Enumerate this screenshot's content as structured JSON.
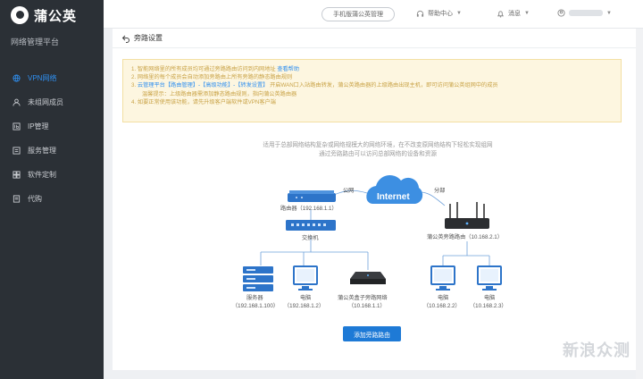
{
  "app": {
    "logo": "蒲公英",
    "subtitle": "网络管理平台"
  },
  "sidebar": {
    "items": [
      {
        "label": "VPN网络",
        "icon": "globe-icon",
        "active": true
      },
      {
        "label": "未组网成员",
        "icon": "user-icon"
      },
      {
        "label": "IP管理",
        "icon": "ip-icon"
      },
      {
        "label": "服务管理",
        "icon": "service-icon"
      },
      {
        "label": "软件定制",
        "icon": "software-icon"
      },
      {
        "label": "代购",
        "icon": "purchase-icon"
      }
    ]
  },
  "topbar": {
    "pill_button": "手机版蒲公英管理",
    "help": "帮助中心",
    "messages": "消息"
  },
  "page": {
    "title": "旁路设置"
  },
  "notice": {
    "line1_prefix": "1. 智能网络里的所有成员均可通过旁路路由访问到内网地址",
    "line1_link": "查看帮助",
    "line2": "2. 网络里的每个成员会自动添加旁路由上所有旁路的静态路由规则",
    "line3_prefix": "3.",
    "line3_blue": "云管理平台【路由管理】-【高级功能】-【转发设置】",
    "line3_rest": "开启WAN口入站路由转发，蒲公英路由器的上级路由出现主机，即可访问蒲公英组网中的成员",
    "line3_sub": "温馨提示：上级路由器需添加静态路由规则，指向蒲公英路由器",
    "line4": "4. 如要正常使用该功能，请先升级客户端软件或VPN客户端"
  },
  "description": {
    "line1": "适用于总部网络结构复杂或网络规模大的网络环境，在不改变原网络结构下轻松实现组网",
    "line2": "通过旁路路由可以访问总部网络的设备和资源"
  },
  "diagram": {
    "internet": "Internet",
    "gateway_tag": "公网",
    "branch_tag": "分部",
    "gateway": "路由器（192.168.1.1）",
    "switch": "交换机",
    "branch_router": "蒲公英旁路路由",
    "branch_router_ip": "（10.168.2.1）",
    "hq_devices": [
      {
        "label": "服务器",
        "ip": "（192.168.1.100）",
        "icon": "server-icon"
      },
      {
        "label": "电脑",
        "ip": "（192.168.1.2）",
        "icon": "computer-icon"
      },
      {
        "label": "蒲公英盒子旁路网络",
        "ip": "（10.168.1.1）",
        "icon": "box-router-icon"
      }
    ],
    "branch_devices": [
      {
        "label": "电脑",
        "ip": "（10.168.2.2）",
        "icon": "computer-icon"
      },
      {
        "label": "电脑",
        "ip": "（10.168.2.3）",
        "icon": "computer-icon"
      }
    ]
  },
  "actions": {
    "add_bypass": "添加旁路路由"
  },
  "watermark": "新浪众测",
  "colors": {
    "sidebar_bg": "#2b3036",
    "accent": "#2f8ff0",
    "notice_bg": "#fdf6e0",
    "primary_button": "#1e7ad6"
  }
}
